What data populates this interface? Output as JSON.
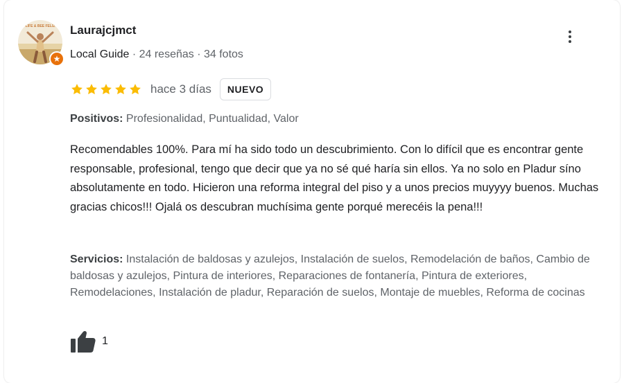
{
  "review": {
    "author": {
      "name": "Laurajcjmct",
      "guide_label": "Local Guide",
      "meta": " · 24 reseñas · 34 fotos",
      "avatar_icon": "user-photo-icon",
      "badge_icon": "local-guide-star-icon",
      "avatar_banner": "LIFE & BEE FELIZ"
    },
    "rating": 5,
    "time_ago": "hace 3 días",
    "badge": "NUEVO",
    "positives": {
      "label": "Positivos:",
      "value": " Profesionalidad, Puntualidad, Valor"
    },
    "text": "Recomendables 100%. Para mí ha sido todo un descubrimiento. Con lo difícil que es encontrar gente responsable, profesional, tengo que decir que ya no sé qué haría sin ellos. Ya no solo en Pladur síno absolutamente en todo. Hicieron una reforma integral del piso y a unos precios muyyyy buenos. Muchas gracias chicos!!! Ojalá os descubran muchísima gente porqué merecéis la pena!!!",
    "services": {
      "label": "Servicios:",
      "value": " Instalación de baldosas y azulejos, Instalación de suelos, Remodelación de baños, Cambio de baldosas y azulejos, Pintura de interiores, Reparaciones de fontanería, Pintura de exteriores, Remodelaciones, Instalación de pladur, Reparación de suelos, Montaje de muebles, Reforma de cocinas"
    },
    "likes": "1",
    "like_icon": "thumbs-up-icon",
    "menu_icon": "more-vertical-icon"
  },
  "colors": {
    "star": "#fbbc04",
    "badge_orange": "#e8710a",
    "text_primary": "#202124",
    "text_secondary": "#5f6368"
  }
}
